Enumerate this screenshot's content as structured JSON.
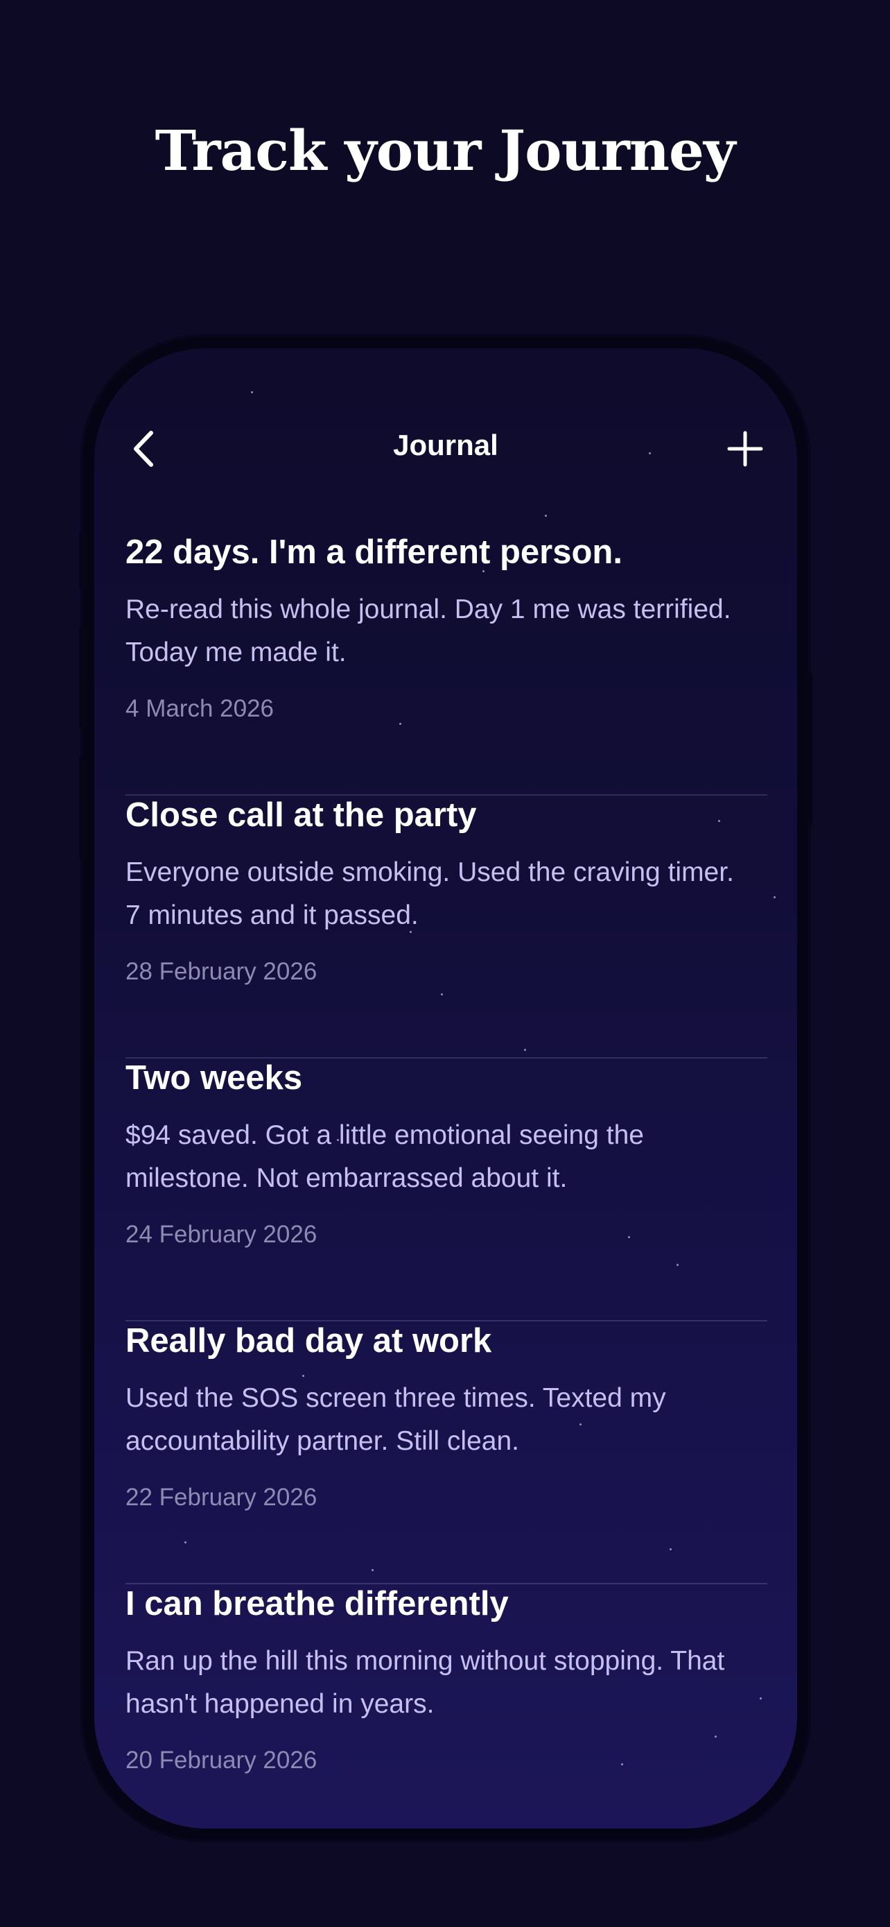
{
  "hero": {
    "title": "Track your Journey"
  },
  "nav": {
    "title": "Journal",
    "back_icon": "chevron-left-icon",
    "add_icon": "plus-icon"
  },
  "entries": [
    {
      "title": "22 days. I'm a different person.",
      "body": "Re-read this whole journal. Day 1 me was terrified. Today me made it.",
      "date": "4 March 2026"
    },
    {
      "title": "Close call at the party",
      "body": "Everyone outside smoking. Used the craving timer. 7 minutes and it passed.",
      "date": "28 February 2026"
    },
    {
      "title": "Two weeks",
      "body": "$94 saved. Got a little emotional seeing the milestone. Not embarrassed about it.",
      "date": "24 February 2026"
    },
    {
      "title": "Really bad day at work",
      "body": "Used the SOS screen three times. Texted my accountability partner. Still clean.",
      "date": "22 February 2026"
    },
    {
      "title": "I can breathe differently",
      "body": "Ran up the hill this morning without stopping. That hasn't happened in years.",
      "date": "20 February 2026"
    }
  ],
  "colors": {
    "background": "#0c0a25",
    "screen_top": "#0e0b2c",
    "screen_bottom": "#1c1658",
    "body_text": "#c6bff0",
    "date_text": "#8f8ab2"
  }
}
